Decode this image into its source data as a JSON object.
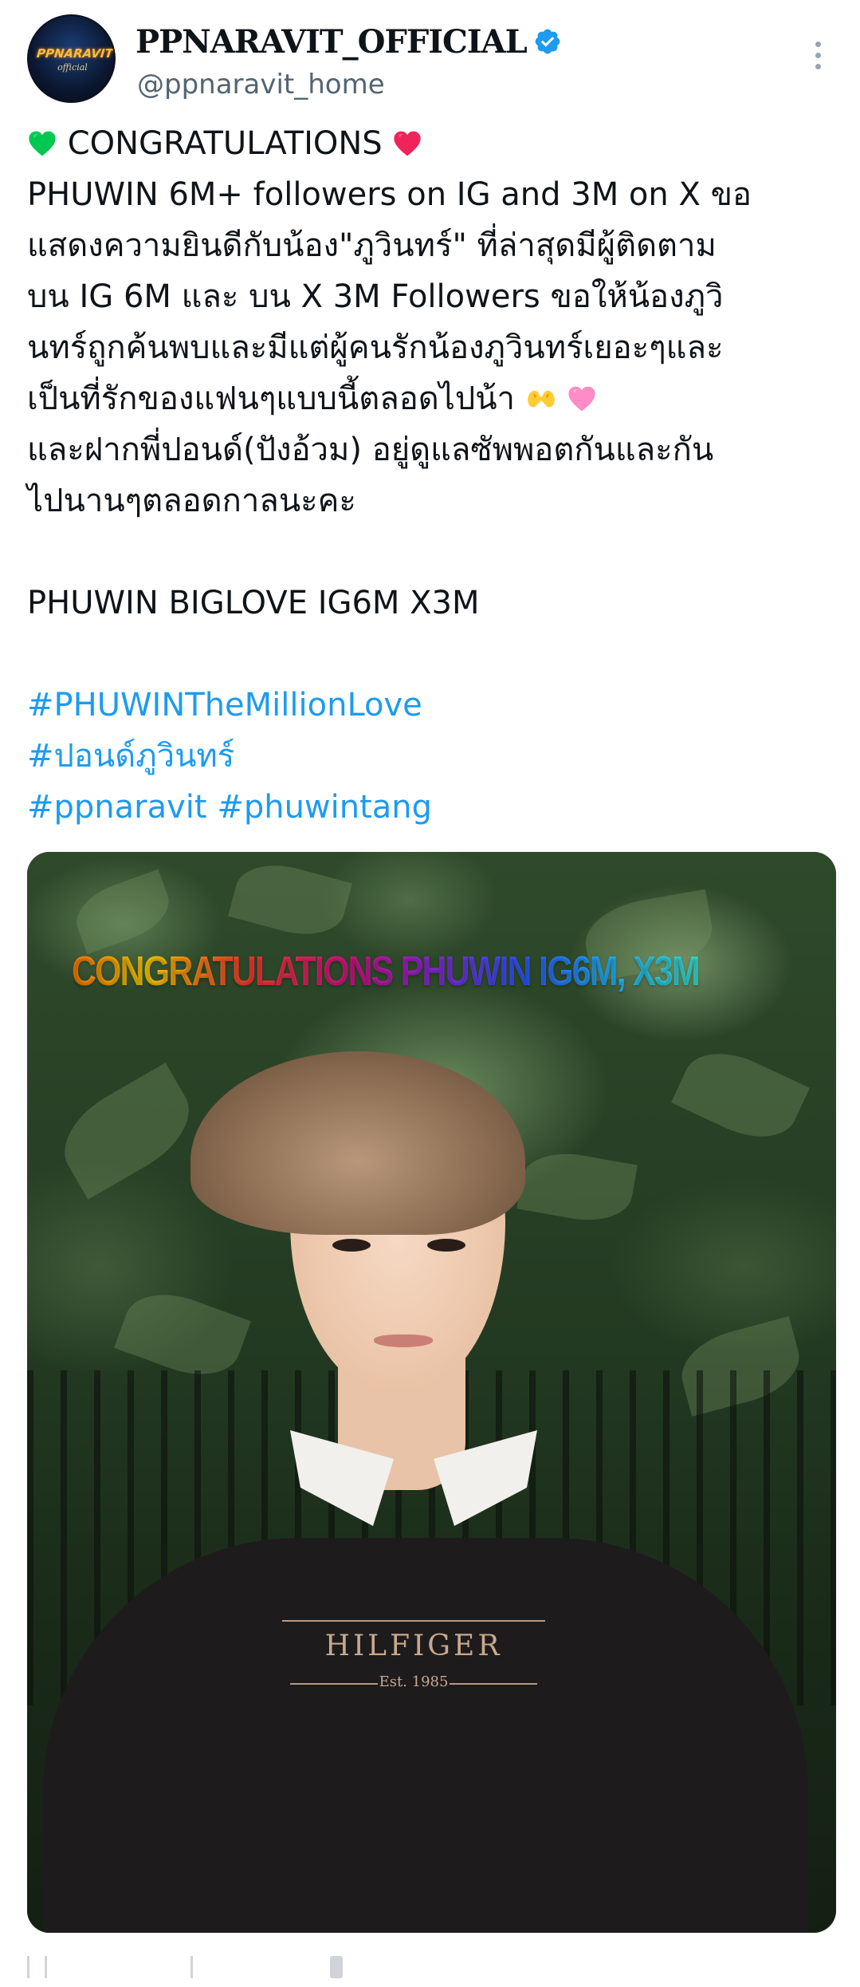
{
  "post": {
    "author": {
      "display_name": "PPNARAVIT_OFFICIAL",
      "handle": "@ppnaravit_home",
      "avatar_logo": "PPNARAVIT",
      "avatar_sub": "official",
      "verified": true
    },
    "body_lines": [
      "CONGRATULATIONS",
      "PHUWIN 6M+ followers on IG and 3M on X  ขอ",
      "แสดงความยินดีกับน้อง\"ภูวินทร์\" ที่ล่าสุดมีผู้ติดตาม",
      "บน IG 6M และ บน X 3M Followers ขอให้น้องภูวิ",
      "นทร์ถูกค้นพบและมีแต่ผู้คนรักน้องภูวินทร์เยอะๆและ",
      "เป็นที่รักของแฟนๆแบบนี้ตลอดไปน้า",
      "และฝากพี่ปอนด์(ปังอ้วม) อยู่ดูแลซัพพอตกันและกัน",
      "ไปนานๆตลอดกาลนะคะ",
      "PHUWIN BIGLOVE IG6M X3M"
    ],
    "hashtags": [
      "#PHUWINTheMillionLove",
      "#ปอนด์ภูวินทร์",
      "#ppnaravit",
      "#phuwintang"
    ],
    "media": {
      "overlay_text": "CONGRATULATIONS PHUWIN IG6M, X3M",
      "sweater_brand": "HILFIGER",
      "sweater_est": "Est. 1985"
    }
  },
  "icons": {
    "verified": "verified-badge-icon",
    "more": "more-options-icon",
    "green_heart": "green-heart-emoji",
    "red_heart": "red-heart-emoji",
    "heart_hands": "heart-hands-emoji",
    "pink_heart": "pink-heart-emoji"
  },
  "colors": {
    "text": "#0f1419",
    "secondary_text": "#536471",
    "link": "#1d9bf0",
    "verified": "#1d9bf0"
  }
}
